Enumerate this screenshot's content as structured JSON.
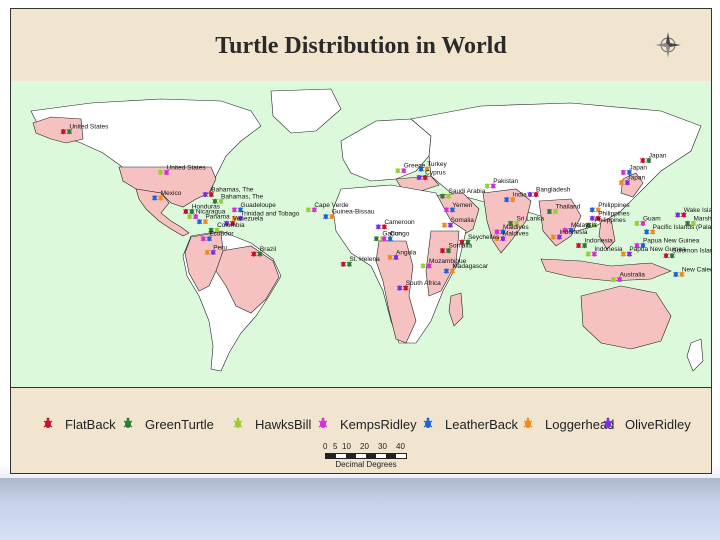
{
  "map": {
    "title": "Turtle Distribution in World",
    "scale": {
      "ticks": [
        "0",
        "5",
        "10",
        "20",
        "30",
        "40"
      ],
      "unit": "Decimal Degrees"
    },
    "colors": {
      "ocean": "#dcfadb",
      "range_country": "#f6c1c1",
      "land": "#ffffff",
      "border": "#222222"
    },
    "legend": [
      {
        "label": "FlatBack",
        "color": "#c8102e"
      },
      {
        "label": "GreenTurtle",
        "color": "#2e7d32"
      },
      {
        "label": "HawksBill",
        "color": "#9acd32"
      },
      {
        "label": "KempsRidley",
        "color": "#d62fd6"
      },
      {
        "label": "LeatherBack",
        "color": "#1e63d6"
      },
      {
        "label": "Loggerhead",
        "color": "#f08a1c"
      },
      {
        "label": "OliveRidley",
        "color": "#7b2fe0"
      }
    ],
    "places": [
      {
        "name": "United States",
        "lon": -150,
        "lat": 62
      },
      {
        "name": "United States",
        "lon": -100,
        "lat": 38
      },
      {
        "name": "Mexico",
        "lon": -103,
        "lat": 23
      },
      {
        "name": "Bahamas, The",
        "lon": -77,
        "lat": 25
      },
      {
        "name": "Bahamas, The",
        "lon": -72,
        "lat": 21
      },
      {
        "name": "Guadeloupe",
        "lon": -62,
        "lat": 16
      },
      {
        "name": "Trinidad and Tobago",
        "lon": -62,
        "lat": 11
      },
      {
        "name": "Honduras",
        "lon": -87,
        "lat": 15
      },
      {
        "name": "Nicaragua",
        "lon": -85,
        "lat": 12
      },
      {
        "name": "Panama",
        "lon": -80,
        "lat": 9
      },
      {
        "name": "Venezuela",
        "lon": -66,
        "lat": 8
      },
      {
        "name": "Colombia",
        "lon": -74,
        "lat": 4
      },
      {
        "name": "Ecuador",
        "lon": -78,
        "lat": -1
      },
      {
        "name": "Peru",
        "lon": -76,
        "lat": -9
      },
      {
        "name": "Brazil",
        "lon": -52,
        "lat": -10
      },
      {
        "name": "Cape Verde",
        "lon": -24,
        "lat": 16
      },
      {
        "name": "Guinea-Bissau",
        "lon": -15,
        "lat": 12
      },
      {
        "name": "Cameroon",
        "lon": 12,
        "lat": 6
      },
      {
        "name": "Gabon",
        "lon": 11,
        "lat": -1
      },
      {
        "name": "Congo",
        "lon": 15,
        "lat": -1
      },
      {
        "name": "Angola",
        "lon": 18,
        "lat": -12
      },
      {
        "name": "St. Helena",
        "lon": -6,
        "lat": -16
      },
      {
        "name": "Greece",
        "lon": 22,
        "lat": 39
      },
      {
        "name": "Turkey",
        "lon": 34,
        "lat": 40
      },
      {
        "name": "Cyprus",
        "lon": 33,
        "lat": 35
      },
      {
        "name": "Saudi Arabia",
        "lon": 45,
        "lat": 24
      },
      {
        "name": "Yemen",
        "lon": 47,
        "lat": 16
      },
      {
        "name": "Somalia",
        "lon": 46,
        "lat": 7
      },
      {
        "name": "Somalia",
        "lon": 45,
        "lat": -8
      },
      {
        "name": "Pakistan",
        "lon": 68,
        "lat": 30
      },
      {
        "name": "India",
        "lon": 78,
        "lat": 22
      },
      {
        "name": "Bangladesh",
        "lon": 90,
        "lat": 25
      },
      {
        "name": "Sri Lanka",
        "lon": 80,
        "lat": 8
      },
      {
        "name": "Maldives",
        "lon": 73,
        "lat": 3
      },
      {
        "name": "Maldives",
        "lon": 73,
        "lat": -1
      },
      {
        "name": "Seychelles",
        "lon": 55,
        "lat": -3
      },
      {
        "name": "Mozambique",
        "lon": 35,
        "lat": -17
      },
      {
        "name": "Madagascar",
        "lon": 47,
        "lat": -20
      },
      {
        "name": "South Africa",
        "lon": 23,
        "lat": -30
      },
      {
        "name": "Thailand",
        "lon": 100,
        "lat": 15
      },
      {
        "name": "Malaysia",
        "lon": 108,
        "lat": 4
      },
      {
        "name": "Indonesia",
        "lon": 102,
        "lat": 0
      },
      {
        "name": "Indonesia",
        "lon": 115,
        "lat": -5
      },
      {
        "name": "Indonesia",
        "lon": 120,
        "lat": -10
      },
      {
        "name": "Philippines",
        "lon": 122,
        "lat": 16
      },
      {
        "name": "Philippines",
        "lon": 122,
        "lat": 11
      },
      {
        "name": "Philippines",
        "lon": 120,
        "lat": 7
      },
      {
        "name": "Japan",
        "lon": 138,
        "lat": 38
      },
      {
        "name": "Japan",
        "lon": 137,
        "lat": 32
      },
      {
        "name": "Japan",
        "lon": 148,
        "lat": 45
      },
      {
        "name": "Guam",
        "lon": 145,
        "lat": 8
      },
      {
        "name": "Pacific Islands (Palau)",
        "lon": 150,
        "lat": 3
      },
      {
        "name": "Wake Island",
        "lon": 166,
        "lat": 13
      },
      {
        "name": "Marshall Islands",
        "lon": 171,
        "lat": 8
      },
      {
        "name": "Papua New Guinea",
        "lon": 145,
        "lat": -5
      },
      {
        "name": "Papua New Guinea",
        "lon": 138,
        "lat": -10
      },
      {
        "name": "Solomon Islands",
        "lon": 160,
        "lat": -11
      },
      {
        "name": "Australia",
        "lon": 133,
        "lat": -25
      },
      {
        "name": "New Caledonia",
        "lon": 165,
        "lat": -22
      }
    ]
  }
}
